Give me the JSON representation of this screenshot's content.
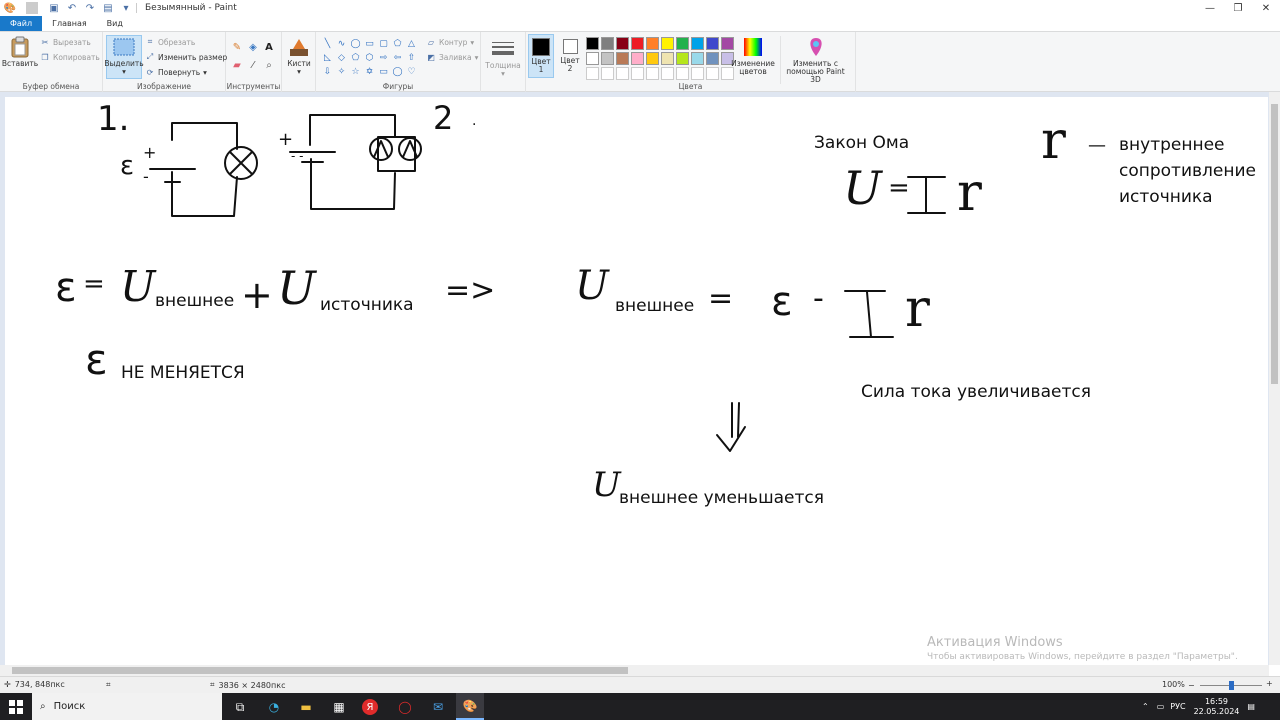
{
  "window": {
    "title": "Безымянный - Paint",
    "minimize": "—",
    "maximize": "❐",
    "close": "✕"
  },
  "tabs": [
    "Файл",
    "Главная",
    "Вид"
  ],
  "ribbon": {
    "clipboard": {
      "label": "Буфер обмена",
      "paste": "Вставить",
      "cut": "Вырезать",
      "copy": "Копировать"
    },
    "image": {
      "label": "Изображение",
      "select": "Выделить",
      "crop": "Обрезать",
      "resize": "Изменить размер",
      "rotate": "Повернуть"
    },
    "tools": {
      "label": "Инструменты",
      "text_tool": "A"
    },
    "brushes": "Кисти",
    "shapes": {
      "label": "Фигуры",
      "outline": "Контур",
      "fill": "Заливка"
    },
    "size": "Толщина",
    "colors": {
      "label": "Цвета",
      "color1": "Цвет 1",
      "color2": "Цвет 2",
      "edit": "Изменение цветов",
      "paint3d": "Изменить с помощью Paint 3D",
      "palette": [
        "#000000",
        "#7f7f7f",
        "#880015",
        "#ed1c24",
        "#ff7f27",
        "#fff200",
        "#22b14c",
        "#00a2e8",
        "#3f48cc",
        "#a349a4",
        "#ffffff",
        "#c3c3c3",
        "#b97a57",
        "#ffaec9",
        "#ffc90e",
        "#efe4b0",
        "#b5e61d",
        "#99d9ea",
        "#7092be",
        "#c8bfe7"
      ]
    }
  },
  "canvas_text": {
    "n1": "1.",
    "n2": "2",
    "eps_small": "ε",
    "plus1": "+",
    "minus1": "-",
    "plus2": "+",
    "minus2": "- -",
    "dot": ".",
    "ohm_title": "Закон Ома",
    "ohm_u": "U",
    "ohm_eq": "=",
    "ohm_i": "I",
    "ohm_r": "r",
    "r_sym": "r",
    "r_dash": "—",
    "r_desc": [
      "внутреннее",
      "сопротивление",
      "источника"
    ],
    "f_eps": "ε",
    "f_eq": "=",
    "f_u1": "U",
    "f_sub1": "внешнее",
    "f_plus": "+",
    "f_u2": "U",
    "f_sub2": "источника",
    "f_implies": "=>",
    "f_u3": "U",
    "f_sub3": "внешнее",
    "f_eq2": "=",
    "f_eps2": "ε",
    "f_minus": "-",
    "f_i": "I",
    "f_r": "r",
    "eps_nc_sym": "ε",
    "eps_nc_text": "НЕ МЕНЯЕТСЯ",
    "current_inc": "Сила тока увеличивается",
    "arrow": "⇓",
    "u_dec_sym": "U",
    "u_dec_text": "внешнее уменьшается"
  },
  "watermark": {
    "title": "Активация Windows",
    "subtitle": "Чтобы активировать Windows, перейдите в раздел \"Параметры\"."
  },
  "status": {
    "cursor": "734, 848пкс",
    "size": "3836 × 2480пкс",
    "zoom": "100%",
    "zoom_level": 0.5
  },
  "taskbar": {
    "search": "Поиск",
    "lang": "РУС",
    "time": "16:59",
    "date": "22.05.2024"
  }
}
